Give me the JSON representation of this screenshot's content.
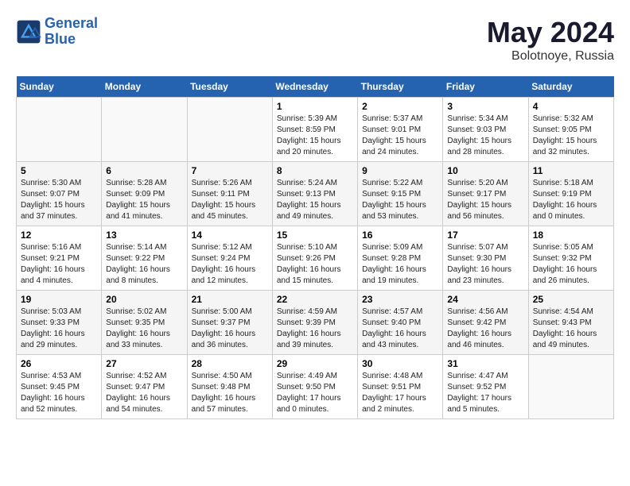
{
  "logo": {
    "line1": "General",
    "line2": "Blue"
  },
  "title": "May 2024",
  "subtitle": "Bolotnoye, Russia",
  "days_header": [
    "Sunday",
    "Monday",
    "Tuesday",
    "Wednesday",
    "Thursday",
    "Friday",
    "Saturday"
  ],
  "weeks": [
    [
      {
        "day": "",
        "sunrise": "",
        "sunset": "",
        "daylight": ""
      },
      {
        "day": "",
        "sunrise": "",
        "sunset": "",
        "daylight": ""
      },
      {
        "day": "",
        "sunrise": "",
        "sunset": "",
        "daylight": ""
      },
      {
        "day": "1",
        "sunrise": "Sunrise: 5:39 AM",
        "sunset": "Sunset: 8:59 PM",
        "daylight": "Daylight: 15 hours and 20 minutes."
      },
      {
        "day": "2",
        "sunrise": "Sunrise: 5:37 AM",
        "sunset": "Sunset: 9:01 PM",
        "daylight": "Daylight: 15 hours and 24 minutes."
      },
      {
        "day": "3",
        "sunrise": "Sunrise: 5:34 AM",
        "sunset": "Sunset: 9:03 PM",
        "daylight": "Daylight: 15 hours and 28 minutes."
      },
      {
        "day": "4",
        "sunrise": "Sunrise: 5:32 AM",
        "sunset": "Sunset: 9:05 PM",
        "daylight": "Daylight: 15 hours and 32 minutes."
      }
    ],
    [
      {
        "day": "5",
        "sunrise": "Sunrise: 5:30 AM",
        "sunset": "Sunset: 9:07 PM",
        "daylight": "Daylight: 15 hours and 37 minutes."
      },
      {
        "day": "6",
        "sunrise": "Sunrise: 5:28 AM",
        "sunset": "Sunset: 9:09 PM",
        "daylight": "Daylight: 15 hours and 41 minutes."
      },
      {
        "day": "7",
        "sunrise": "Sunrise: 5:26 AM",
        "sunset": "Sunset: 9:11 PM",
        "daylight": "Daylight: 15 hours and 45 minutes."
      },
      {
        "day": "8",
        "sunrise": "Sunrise: 5:24 AM",
        "sunset": "Sunset: 9:13 PM",
        "daylight": "Daylight: 15 hours and 49 minutes."
      },
      {
        "day": "9",
        "sunrise": "Sunrise: 5:22 AM",
        "sunset": "Sunset: 9:15 PM",
        "daylight": "Daylight: 15 hours and 53 minutes."
      },
      {
        "day": "10",
        "sunrise": "Sunrise: 5:20 AM",
        "sunset": "Sunset: 9:17 PM",
        "daylight": "Daylight: 15 hours and 56 minutes."
      },
      {
        "day": "11",
        "sunrise": "Sunrise: 5:18 AM",
        "sunset": "Sunset: 9:19 PM",
        "daylight": "Daylight: 16 hours and 0 minutes."
      }
    ],
    [
      {
        "day": "12",
        "sunrise": "Sunrise: 5:16 AM",
        "sunset": "Sunset: 9:21 PM",
        "daylight": "Daylight: 16 hours and 4 minutes."
      },
      {
        "day": "13",
        "sunrise": "Sunrise: 5:14 AM",
        "sunset": "Sunset: 9:22 PM",
        "daylight": "Daylight: 16 hours and 8 minutes."
      },
      {
        "day": "14",
        "sunrise": "Sunrise: 5:12 AM",
        "sunset": "Sunset: 9:24 PM",
        "daylight": "Daylight: 16 hours and 12 minutes."
      },
      {
        "day": "15",
        "sunrise": "Sunrise: 5:10 AM",
        "sunset": "Sunset: 9:26 PM",
        "daylight": "Daylight: 16 hours and 15 minutes."
      },
      {
        "day": "16",
        "sunrise": "Sunrise: 5:09 AM",
        "sunset": "Sunset: 9:28 PM",
        "daylight": "Daylight: 16 hours and 19 minutes."
      },
      {
        "day": "17",
        "sunrise": "Sunrise: 5:07 AM",
        "sunset": "Sunset: 9:30 PM",
        "daylight": "Daylight: 16 hours and 23 minutes."
      },
      {
        "day": "18",
        "sunrise": "Sunrise: 5:05 AM",
        "sunset": "Sunset: 9:32 PM",
        "daylight": "Daylight: 16 hours and 26 minutes."
      }
    ],
    [
      {
        "day": "19",
        "sunrise": "Sunrise: 5:03 AM",
        "sunset": "Sunset: 9:33 PM",
        "daylight": "Daylight: 16 hours and 29 minutes."
      },
      {
        "day": "20",
        "sunrise": "Sunrise: 5:02 AM",
        "sunset": "Sunset: 9:35 PM",
        "daylight": "Daylight: 16 hours and 33 minutes."
      },
      {
        "day": "21",
        "sunrise": "Sunrise: 5:00 AM",
        "sunset": "Sunset: 9:37 PM",
        "daylight": "Daylight: 16 hours and 36 minutes."
      },
      {
        "day": "22",
        "sunrise": "Sunrise: 4:59 AM",
        "sunset": "Sunset: 9:39 PM",
        "daylight": "Daylight: 16 hours and 39 minutes."
      },
      {
        "day": "23",
        "sunrise": "Sunrise: 4:57 AM",
        "sunset": "Sunset: 9:40 PM",
        "daylight": "Daylight: 16 hours and 43 minutes."
      },
      {
        "day": "24",
        "sunrise": "Sunrise: 4:56 AM",
        "sunset": "Sunset: 9:42 PM",
        "daylight": "Daylight: 16 hours and 46 minutes."
      },
      {
        "day": "25",
        "sunrise": "Sunrise: 4:54 AM",
        "sunset": "Sunset: 9:43 PM",
        "daylight": "Daylight: 16 hours and 49 minutes."
      }
    ],
    [
      {
        "day": "26",
        "sunrise": "Sunrise: 4:53 AM",
        "sunset": "Sunset: 9:45 PM",
        "daylight": "Daylight: 16 hours and 52 minutes."
      },
      {
        "day": "27",
        "sunrise": "Sunrise: 4:52 AM",
        "sunset": "Sunset: 9:47 PM",
        "daylight": "Daylight: 16 hours and 54 minutes."
      },
      {
        "day": "28",
        "sunrise": "Sunrise: 4:50 AM",
        "sunset": "Sunset: 9:48 PM",
        "daylight": "Daylight: 16 hours and 57 minutes."
      },
      {
        "day": "29",
        "sunrise": "Sunrise: 4:49 AM",
        "sunset": "Sunset: 9:50 PM",
        "daylight": "Daylight: 17 hours and 0 minutes."
      },
      {
        "day": "30",
        "sunrise": "Sunrise: 4:48 AM",
        "sunset": "Sunset: 9:51 PM",
        "daylight": "Daylight: 17 hours and 2 minutes."
      },
      {
        "day": "31",
        "sunrise": "Sunrise: 4:47 AM",
        "sunset": "Sunset: 9:52 PM",
        "daylight": "Daylight: 17 hours and 5 minutes."
      },
      {
        "day": "",
        "sunrise": "",
        "sunset": "",
        "daylight": ""
      }
    ]
  ]
}
